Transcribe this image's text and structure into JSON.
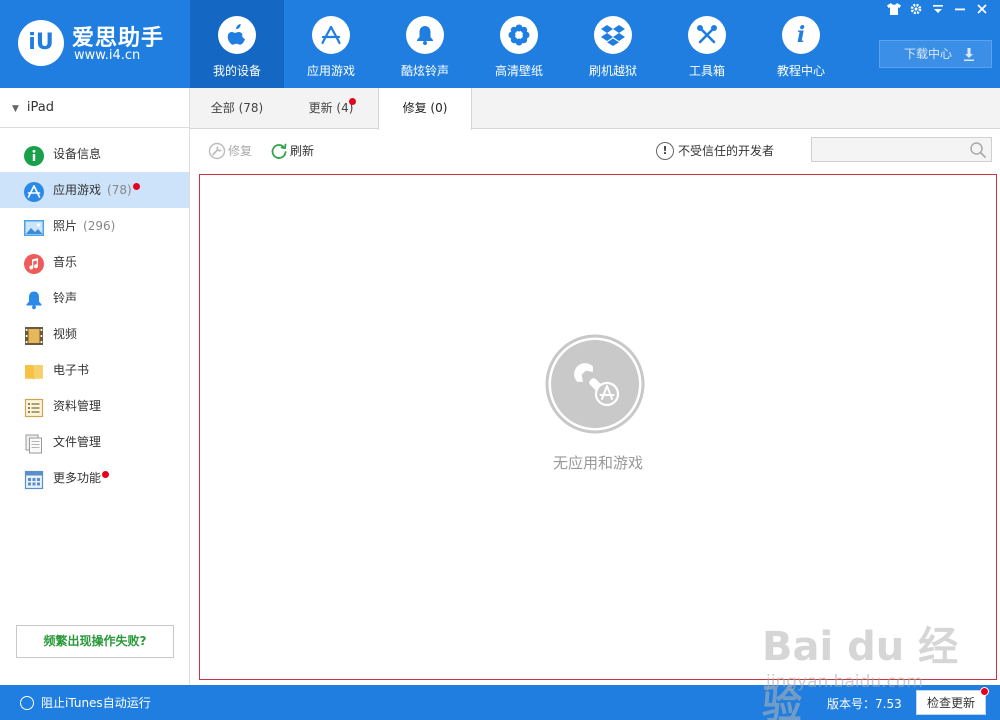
{
  "logo": {
    "badge_text": "iU",
    "name": "爱思助手",
    "url": "www.i4.cn"
  },
  "nav": {
    "tabs": [
      {
        "label": "我的设备",
        "icon": "apple-icon",
        "active": true
      },
      {
        "label": "应用游戏",
        "icon": "app-store-icon",
        "active": false
      },
      {
        "label": "酷炫铃声",
        "icon": "bell-icon",
        "active": false
      },
      {
        "label": "高清壁纸",
        "icon": "flower-icon",
        "active": false
      },
      {
        "label": "刷机越狱",
        "icon": "dropbox-icon",
        "active": false
      },
      {
        "label": "工具箱",
        "icon": "tools-icon",
        "active": false
      },
      {
        "label": "教程中心",
        "icon": "info-icon",
        "active": false
      }
    ],
    "download_center": "下载中心"
  },
  "window_controls": [
    "shirt-icon",
    "gear-icon",
    "menu-icon",
    "minimize-icon",
    "close-icon"
  ],
  "sidebar": {
    "device": "iPad",
    "items": [
      {
        "label": "设备信息",
        "icon": "info-icon",
        "count": "",
        "active": false,
        "dot": false
      },
      {
        "label": "应用游戏",
        "icon": "app-store-icon",
        "count": "(78)",
        "active": true,
        "dot": true
      },
      {
        "label": "照片",
        "icon": "photo-icon",
        "count": "(296)",
        "active": false,
        "dot": false
      },
      {
        "label": "音乐",
        "icon": "music-icon",
        "count": "",
        "active": false,
        "dot": false
      },
      {
        "label": "铃声",
        "icon": "bell-icon",
        "count": "",
        "active": false,
        "dot": false
      },
      {
        "label": "视频",
        "icon": "film-icon",
        "count": "",
        "active": false,
        "dot": false
      },
      {
        "label": "电子书",
        "icon": "book-icon",
        "count": "",
        "active": false,
        "dot": false
      },
      {
        "label": "资料管理",
        "icon": "contacts-icon",
        "count": "",
        "active": false,
        "dot": false
      },
      {
        "label": "文件管理",
        "icon": "files-icon",
        "count": "",
        "active": false,
        "dot": false
      },
      {
        "label": "更多功能",
        "icon": "grid-icon",
        "count": "",
        "active": false,
        "dot": true
      }
    ],
    "fail_button": "频繁出现操作失败?"
  },
  "subtabs": [
    {
      "label": "全部 (78)",
      "active": false,
      "dot": false
    },
    {
      "label": "更新 (4)",
      "active": false,
      "dot": true
    },
    {
      "label": "修复 (0)",
      "active": true,
      "dot": false
    }
  ],
  "toolbar": {
    "repair": "修复",
    "refresh": "刷新",
    "untrusted": "不受信任的开发者",
    "search_placeholder": ""
  },
  "empty_state": {
    "text": "无应用和游戏"
  },
  "statusbar": {
    "itunes_toggle": "阻止iTunes自动运行",
    "version": "版本号：7.53",
    "check_update": "检查更新"
  },
  "watermark": {
    "main": "Bai du 经验",
    "sub": "jingyan.baidu.com"
  },
  "colors": {
    "brand_blue": "#1f7ee0",
    "active_nav": "#1468c4",
    "sidebar_active": "#cde3f9",
    "badge_red": "#e6001c",
    "green": "#2a9a3b"
  }
}
